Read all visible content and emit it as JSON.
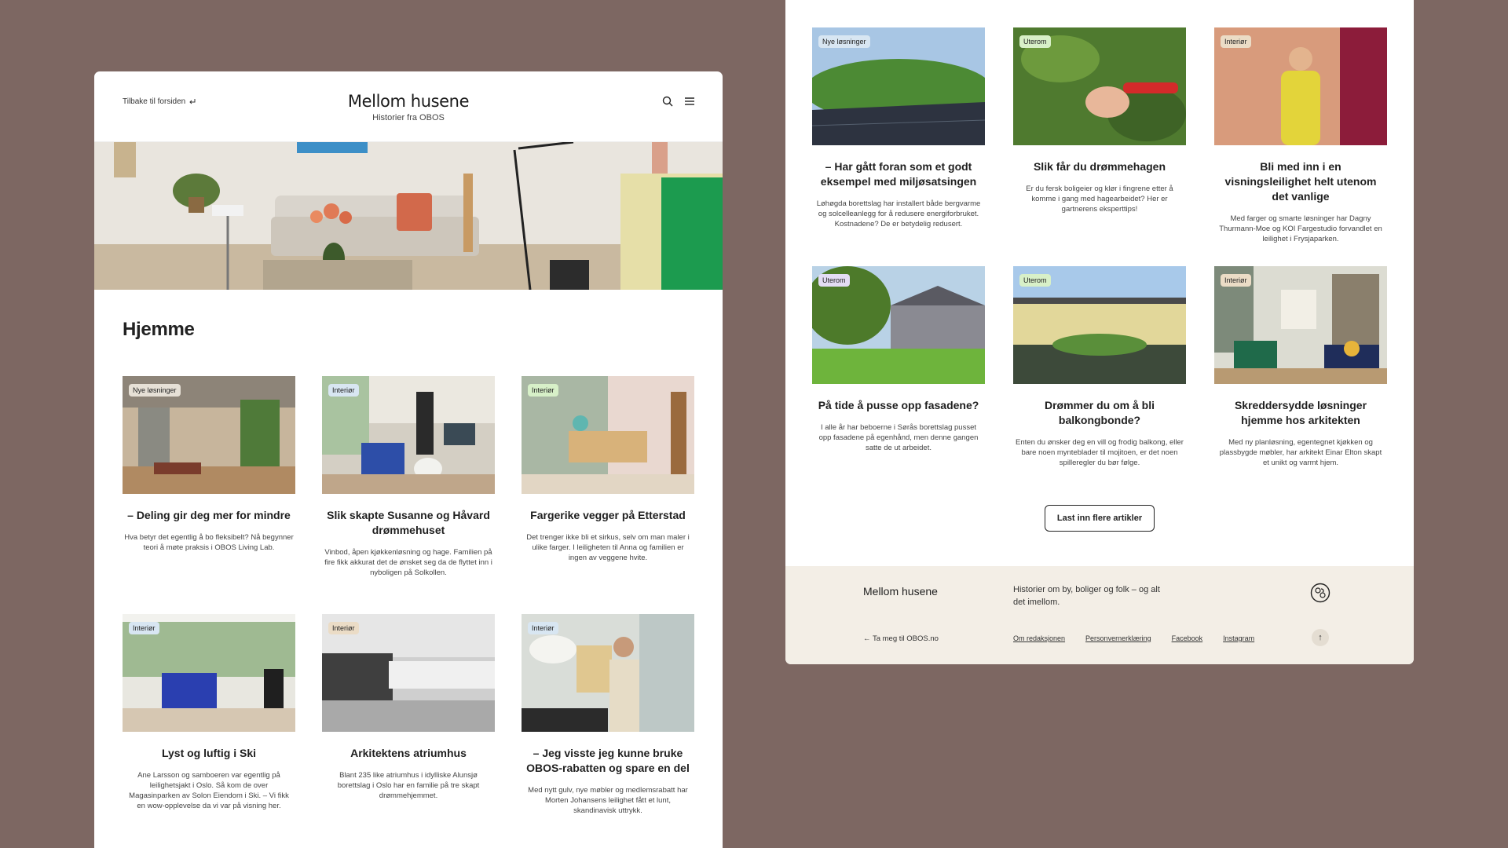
{
  "header": {
    "back_label": "Tilbake til forsiden",
    "site_title": "Mellom husene",
    "site_subtitle": "Historier fra OBOS"
  },
  "section_title": "Hjemme",
  "left_cards": [
    {
      "tag": "Nye løsninger",
      "title": "– Deling gir deg mer for mindre",
      "desc": "Hva betyr det egentlig å bo fleksibelt? Nå begynner teori å møte praksis i OBOS Living Lab."
    },
    {
      "tag": "Interiør",
      "title": "Slik skapte Susanne og Håvard drømmehuset",
      "desc": "Vinbod, åpen kjøkkenløsning og hage. Familien på fire fikk akkurat det de ønsket seg da de flyttet inn i nyboligen på Solkollen."
    },
    {
      "tag": "Interiør",
      "title": "Fargerike vegger på Etterstad",
      "desc": "Det trenger ikke bli et sirkus, selv om man maler i ulike farger. I leiligheten til Anna og familien er ingen av veggene hvite."
    },
    {
      "tag": "Interiør",
      "title": "Lyst og luftig i Ski",
      "desc": "Ane Larsson og samboeren var egentlig på leilighetsjakt i Oslo. Så kom de over Magasinparken av Solon Eiendom i Ski. – Vi fikk en wow-opplevelse da vi var på visning her."
    },
    {
      "tag": "Interiør",
      "title": "Arkitektens atriumhus",
      "desc": "Blant 235 like atriumhus i idylliske Alunsjø borettslag i Oslo har en familie på tre skapt drømmehjemmet."
    },
    {
      "tag": "Interiør",
      "title": "– Jeg visste jeg kunne bruke OBOS-rabatten og spare en del",
      "desc": "Med nytt gulv, nye møbler og medlemsrabatt har Morten Johansens leilighet fått et lunt, skandinavisk uttrykk."
    }
  ],
  "right_cards": [
    {
      "tag": "Nye løsninger",
      "title": "– Har gått foran som et godt eksempel med miljøsatsingen",
      "desc": "Løhøgda borettslag har installert både bergvarme og solcelleanlegg for å redusere energiforbruket. Kostnadene? De er betydelig redusert."
    },
    {
      "tag": "Uterom",
      "title": "Slik får du drømmehagen",
      "desc": "Er du fersk boligeier og klør i fingrene etter å komme i gang med hagearbeidet? Her er gartnerens eksperttips!"
    },
    {
      "tag": "Interiør",
      "title": "Bli med inn i en visningsleilighet helt utenom det vanlige",
      "desc": "Med farger og smarte løsninger har Dagny Thurmann-Moe og KOI Fargestudio forvandlet en leilighet i Frysjaparken."
    },
    {
      "tag": "Uterom",
      "title": "På tide å pusse opp fasadene?",
      "desc": "I alle år har beboerne i Sørås borettslag pusset opp fasadene på egenhånd, men denne gangen satte de ut arbeidet."
    },
    {
      "tag": "Uterom",
      "title": "Drømmer du om å bli balkongbonde?",
      "desc": "Enten du ønsker deg en vill og frodig balkong, eller bare noen mynteblader til mojitoen, er det noen spilleregler du bør følge."
    },
    {
      "tag": "Interiør",
      "title": "Skreddersydde løsninger hjemme hos arkitekten",
      "desc": "Med ny planløsning, egentegnet kjøkken og plassbygde møbler, har arkitekt Einar Elton skapt et unikt og varmt hjem."
    }
  ],
  "load_more_label": "Last inn flere artikler",
  "footer": {
    "brand": "Mellom husene",
    "tagline": "Historier om by, boliger og folk – og alt det imellom.",
    "back_label": "← Ta meg til OBOS.no",
    "links": [
      "Om redaksjonen",
      "Personvernerklæring",
      "Facebook",
      "Instagram"
    ],
    "to_top": "↑"
  }
}
